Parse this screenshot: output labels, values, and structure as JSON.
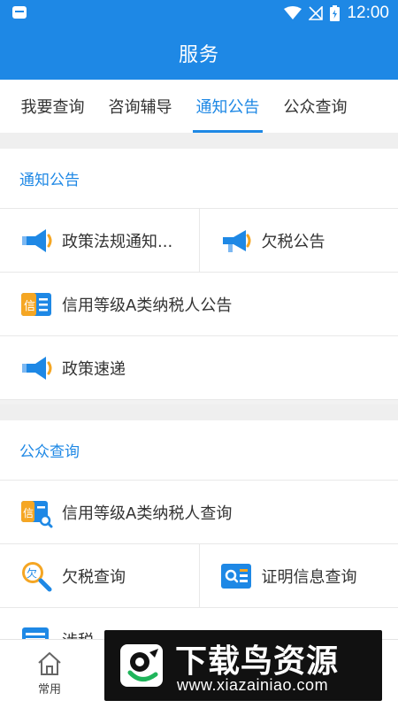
{
  "status_bar": {
    "time": "12:00",
    "icons": [
      "notification-icon",
      "wifi-icon",
      "no-signal-icon",
      "battery-charging-icon"
    ]
  },
  "header": {
    "title": "服务"
  },
  "tabs": [
    {
      "label": "我要查询",
      "active": false
    },
    {
      "label": "咨询辅导",
      "active": false
    },
    {
      "label": "通知公告",
      "active": true
    },
    {
      "label": "公众查询",
      "active": false
    }
  ],
  "sections": {
    "notices": {
      "title": "通知公告",
      "items": [
        {
          "label": "政策法规通知...",
          "icon": "megaphone-icon"
        },
        {
          "label": "欠税公告",
          "icon": "megaphone-icon"
        },
        {
          "label": "信用等级A类纳税人公告",
          "icon": "credit-list-icon"
        },
        {
          "label": "政策速递",
          "icon": "megaphone-icon"
        }
      ]
    },
    "public_query": {
      "title": "公众查询",
      "items": [
        {
          "label": "信用等级A类纳税人查询",
          "icon": "credit-search-icon"
        },
        {
          "label": "欠税查询",
          "icon": "tax-search-icon"
        },
        {
          "label": "证明信息查询",
          "icon": "certificate-search-icon"
        },
        {
          "label": "涉税",
          "icon": "document-icon"
        }
      ]
    }
  },
  "bottom_nav": [
    {
      "label": "常用",
      "icon": "home-icon"
    }
  ],
  "watermark": {
    "title": "下载鸟资源",
    "url": "www.xiazainiao.com"
  },
  "colors": {
    "primary": "#1e88e5",
    "accent_orange": "#f5a623",
    "background": "#efefef"
  }
}
